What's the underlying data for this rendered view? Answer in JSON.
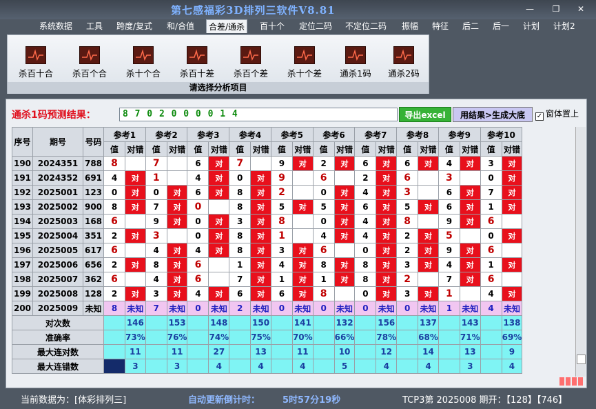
{
  "window": {
    "title": "第七感福彩3D排列三软件V8.81"
  },
  "menu": [
    "系统数据",
    "工具",
    "跨度/复式",
    "和/合值",
    "合差/通杀",
    "百十个",
    "定位二码",
    "不定位二码",
    "振幅",
    "特征",
    "后二",
    "后一",
    "计划",
    "计划2"
  ],
  "ribbon": {
    "items": [
      "杀百十合",
      "杀百个合",
      "杀十个合",
      "杀百十差",
      "杀百个差",
      "杀十个差",
      "通杀1码",
      "通杀2码"
    ],
    "footer": "请选择分析项目"
  },
  "prediction": {
    "label": "通杀1码预测结果：",
    "value": "8 7 0 2 0 0 0 0 1 4",
    "excel_button": "导出excel",
    "generate_button": "用结果>生成大底",
    "topmost_label": "窗体置上"
  },
  "table": {
    "col_headers": {
      "seq": "序号",
      "period": "期号",
      "code": "号码",
      "value": "值",
      "hit": "对错"
    },
    "refs": [
      "参考1",
      "参考2",
      "参考3",
      "参考4",
      "参考5",
      "参考6",
      "参考7",
      "参考8",
      "参考9",
      "参考10"
    ],
    "hit_text": "对",
    "rows": [
      {
        "seq": "190",
        "period": "2024351",
        "code": "788",
        "vals": [
          "8",
          "7",
          "6",
          "7",
          "9",
          "2",
          "6",
          "6",
          "4",
          "3"
        ],
        "hits": [
          0,
          0,
          1,
          0,
          1,
          1,
          1,
          1,
          1,
          1
        ]
      },
      {
        "seq": "191",
        "period": "2024352",
        "code": "691",
        "vals": [
          "4",
          "1",
          "4",
          "0",
          "9",
          "6",
          "2",
          "6",
          "3",
          "0"
        ],
        "hits": [
          1,
          0,
          1,
          1,
          0,
          0,
          1,
          0,
          0,
          1
        ]
      },
      {
        "seq": "192",
        "period": "2025001",
        "code": "123",
        "vals": [
          "0",
          "0",
          "6",
          "8",
          "2",
          "0",
          "4",
          "3",
          "6",
          "7"
        ],
        "hits": [
          1,
          1,
          1,
          1,
          0,
          1,
          1,
          0,
          1,
          1
        ]
      },
      {
        "seq": "193",
        "period": "2025002",
        "code": "900",
        "vals": [
          "8",
          "7",
          "0",
          "8",
          "5",
          "5",
          "6",
          "5",
          "6",
          "1"
        ],
        "hits": [
          1,
          1,
          0,
          1,
          1,
          1,
          1,
          1,
          1,
          1
        ]
      },
      {
        "seq": "194",
        "period": "2025003",
        "code": "168",
        "vals": [
          "6",
          "9",
          "0",
          "3",
          "8",
          "0",
          "4",
          "8",
          "9",
          "6"
        ],
        "hits": [
          0,
          1,
          1,
          1,
          0,
          1,
          1,
          0,
          1,
          0
        ]
      },
      {
        "seq": "195",
        "period": "2025004",
        "code": "351",
        "vals": [
          "2",
          "3",
          "0",
          "8",
          "1",
          "4",
          "4",
          "2",
          "5",
          "0"
        ],
        "hits": [
          1,
          0,
          1,
          1,
          0,
          1,
          1,
          1,
          0,
          1
        ]
      },
      {
        "seq": "196",
        "period": "2025005",
        "code": "617",
        "vals": [
          "6",
          "4",
          "4",
          "8",
          "3",
          "6",
          "0",
          "2",
          "9",
          "6"
        ],
        "hits": [
          0,
          1,
          1,
          1,
          1,
          0,
          1,
          1,
          1,
          0
        ]
      },
      {
        "seq": "197",
        "period": "2025006",
        "code": "656",
        "vals": [
          "2",
          "8",
          "6",
          "1",
          "4",
          "8",
          "8",
          "3",
          "4",
          "1"
        ],
        "hits": [
          1,
          1,
          0,
          1,
          1,
          1,
          1,
          1,
          1,
          1
        ]
      },
      {
        "seq": "198",
        "period": "2025007",
        "code": "362",
        "vals": [
          "6",
          "4",
          "6",
          "7",
          "1",
          "1",
          "8",
          "2",
          "7",
          "6"
        ],
        "hits": [
          0,
          1,
          0,
          1,
          1,
          1,
          1,
          0,
          1,
          0
        ]
      },
      {
        "seq": "199",
        "period": "2025008",
        "code": "128",
        "vals": [
          "2",
          "3",
          "4",
          "6",
          "6",
          "8",
          "0",
          "3",
          "1",
          "4"
        ],
        "hits": [
          1,
          1,
          1,
          1,
          1,
          0,
          1,
          1,
          0,
          1
        ]
      }
    ],
    "pending": {
      "seq": "200",
      "period": "2025009",
      "code": "未知",
      "vals": [
        "8",
        "7",
        "0",
        "2",
        "0",
        "0",
        "0",
        "0",
        "1",
        "4"
      ],
      "hit_text": "未知"
    },
    "stats": [
      {
        "label": "对次数",
        "vals": [
          "146",
          "153",
          "148",
          "150",
          "141",
          "132",
          "156",
          "137",
          "143",
          "138"
        ]
      },
      {
        "label": "准确率",
        "vals": [
          "73%",
          "76%",
          "74%",
          "75%",
          "70%",
          "66%",
          "78%",
          "68%",
          "71%",
          "69%"
        ]
      },
      {
        "label": "最大连对数",
        "vals": [
          "11",
          "11",
          "27",
          "13",
          "11",
          "10",
          "12",
          "14",
          "13",
          "9"
        ]
      },
      {
        "label": "最大连错数",
        "vals": [
          "3",
          "3",
          "4",
          "4",
          "4",
          "5",
          "4",
          "4",
          "3",
          "4"
        ]
      }
    ]
  },
  "status": {
    "current_label": "当前数据为：[体彩排列三]",
    "countdown_label": "自动更新倒计时：",
    "countdown": "5时57分19秒",
    "issue_info": "TCP3第 2025008 期开：【128】【746】"
  },
  "colors": {
    "hit": "#e8101c",
    "pending": "#f1c6f1",
    "stats": "#7ff4f4",
    "title": "#7fb2ff"
  }
}
